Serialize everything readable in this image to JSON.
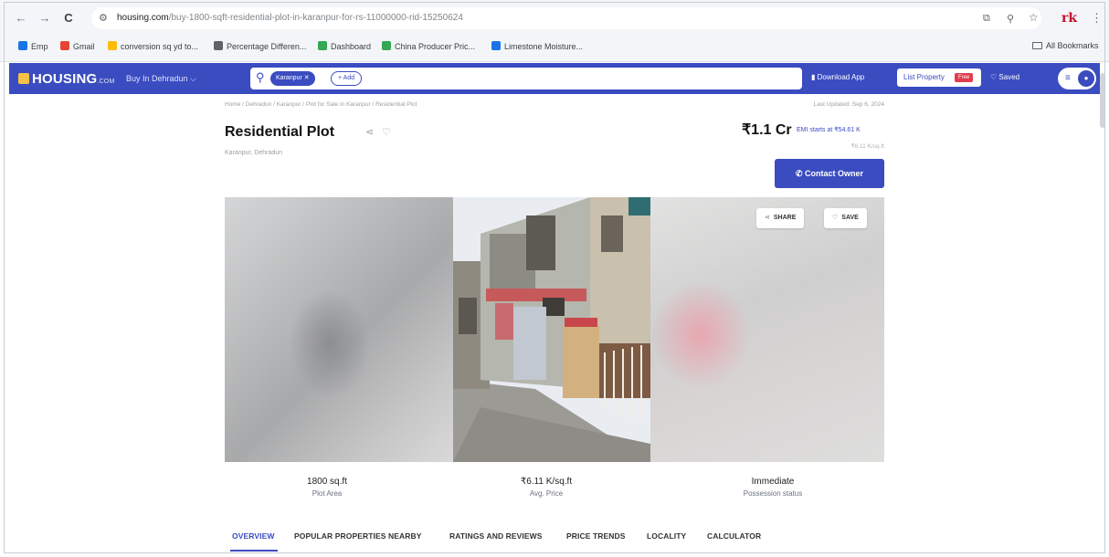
{
  "browser": {
    "url_host": "housing.com",
    "url_path": "/buy-1800-sqft-residential-plot-in-karanpur-for-rs-11000000-rid-15250624",
    "profile_initials": "rk",
    "bookmarks": [
      {
        "label": "Emp",
        "color": "#1a73e8"
      },
      {
        "label": "Gmail",
        "color": "#ea4335"
      },
      {
        "label": "conversion sq yd to...",
        "color": "#fbbc05"
      },
      {
        "label": "Percentage Differen...",
        "color": "#5f6368"
      },
      {
        "label": "Dashboard",
        "color": "#34a853"
      },
      {
        "label": "China Producer Pric...",
        "color": "#34a853"
      },
      {
        "label": "Limestone Moisture...",
        "color": "#1a73e8"
      }
    ],
    "all_bookmarks": "All Bookmarks"
  },
  "header": {
    "logo_main": "HOUSING",
    "logo_suffix": ".COM",
    "city_select": "Buy In Dehradun",
    "search_chip": "Karanpur",
    "add_chip": "+ Add",
    "download_app": "Download App",
    "list_property": "List Property",
    "free_badge": "Free",
    "saved": "Saved",
    "colors": {
      "brand": "#3a4cc0",
      "accent": "#f6c144",
      "badge": "#e23c4f"
    }
  },
  "listing": {
    "breadcrumb": "Home / Dehradun / Karanpur / Plot for Sale in Karanpur / Residential Plot",
    "last_updated": "Last Updated: Sep 6, 2024",
    "title": "Residential Plot",
    "location": "Karanpur, Dehradun",
    "price": "₹1.1 Cr",
    "emi": "EMI starts at ₹54.61 K",
    "price_per_sqft_top": "₹6.11 K/sq.ft",
    "contact_button": "Contact Owner",
    "share": "SHARE",
    "save": "SAVE"
  },
  "stats": [
    {
      "value": "1800 sq.ft",
      "label": "Plot Area"
    },
    {
      "value": "₹6.11 K/sq.ft",
      "label": "Avg. Price"
    },
    {
      "value": "Immediate",
      "label": "Possession status"
    }
  ],
  "tabs": [
    {
      "label": "OVERVIEW",
      "active": true
    },
    {
      "label": "POPULAR PROPERTIES NEARBY",
      "active": false
    },
    {
      "label": "RATINGS AND REVIEWS",
      "active": false
    },
    {
      "label": "PRICE TRENDS",
      "active": false
    },
    {
      "label": "LOCALITY",
      "active": false
    },
    {
      "label": "CALCULATOR",
      "active": false
    }
  ]
}
